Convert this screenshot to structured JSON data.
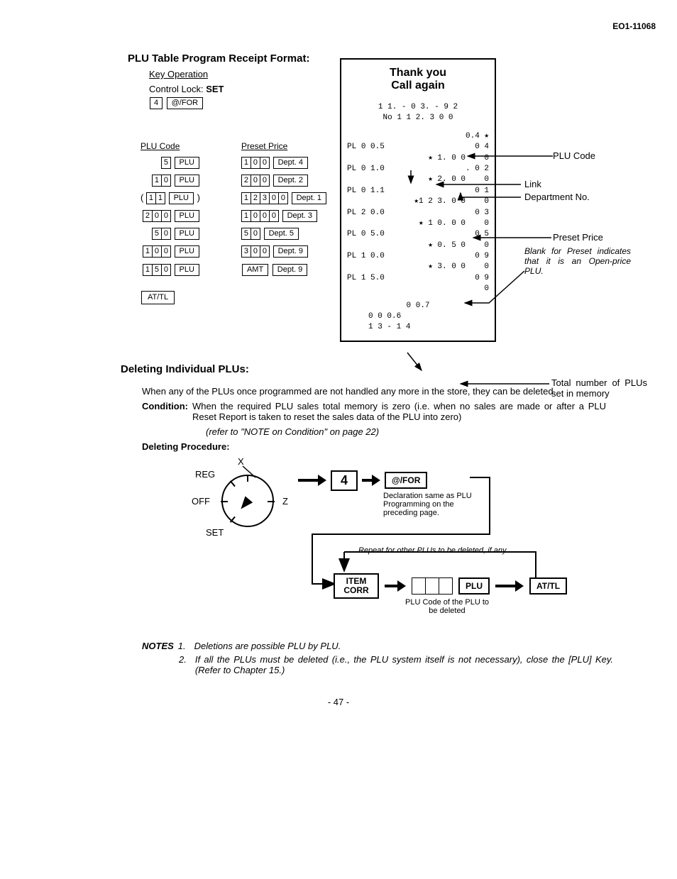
{
  "doc_id": "EO1-11068",
  "section1_title": "PLU Table Program Receipt Format:",
  "key_operation": "Key Operation",
  "control_lock": "Control Lock:",
  "control_lock_val": "SET",
  "first_keys": {
    "digit": "4",
    "key": "@/FOR"
  },
  "col_headers": {
    "plu": "PLU Code",
    "price": "Preset Price"
  },
  "plu_rows": [
    {
      "code": "5",
      "codekey": "PLU",
      "price": "100",
      "dept": "Dept. 4",
      "paren": false
    },
    {
      "code": "10",
      "codekey": "PLU",
      "price": "200",
      "dept": "Dept. 2",
      "paren": false
    },
    {
      "code": "11",
      "codekey": "PLU",
      "price": "12300",
      "dept": "Dept. 1",
      "paren": true
    },
    {
      "code": "200",
      "codekey": "PLU",
      "price": "1000",
      "dept": "Dept. 3",
      "paren": false
    },
    {
      "code": "50",
      "codekey": "PLU",
      "price": "50",
      "dept": "Dept. 5",
      "paren": false
    },
    {
      "code": "100",
      "codekey": "PLU",
      "price": "300",
      "dept": "Dept. 9",
      "paren": false
    },
    {
      "code": "150",
      "codekey": "PLU",
      "price": "AMT",
      "dept": "Dept. 9",
      "paren": false,
      "amt": true
    }
  ],
  "final_key": "AT/TL",
  "receipt": {
    "thank": "Thank you",
    "call": "Call  again",
    "date": "1 1. - 0 3. - 9 2",
    "no": "No 1 1 2. 3 0 0",
    "lines": [
      {
        "l": "",
        "r": "0.4 ★",
        "indent": 10
      },
      {
        "l": "PL 0 0.5",
        "r": "0 4"
      },
      {
        "l": "",
        "r": "★ 1. 0 0    0"
      },
      {
        "l": "PL 0 1.0",
        "r": ". 0 2"
      },
      {
        "l": "",
        "r": "★ 2. 0 0    0"
      },
      {
        "l": "PL 0 1.1",
        "r": "0 1"
      },
      {
        "l": "",
        "r": "★1 2 3. 0 0    0"
      },
      {
        "l": "PL 2 0.0",
        "r": "0 3"
      },
      {
        "l": "",
        "r": "★ 1 0. 0 0    0"
      },
      {
        "l": "PL 0 5.0",
        "r": "0 5"
      },
      {
        "l": "",
        "r": "★ 0. 5 0    0"
      },
      {
        "l": "PL 1 0.0",
        "r": "0 9"
      },
      {
        "l": "",
        "r": "★ 3. 0 0    0"
      },
      {
        "l": "PL 1 5.0",
        "r": "0 9"
      },
      {
        "l": "",
        "r": "0"
      }
    ],
    "foot1": "0 0.7",
    "foot2": "0 0 0.6",
    "foot3": "1 3 - 1 4"
  },
  "annotations": {
    "plu_code": "PLU Code",
    "link": "Link",
    "dept_no": "Department No.",
    "preset": "Preset Price",
    "preset_note": "Blank for Preset indicates that it is an Open-price PLU.",
    "total": "Total number of PLUs set in memory"
  },
  "deleting": {
    "title": "Deleting Individual PLUs:",
    "p1": "When any of the PLUs once programmed are not handled any more in the store, they can be deleted.",
    "cond_label": "Condition:",
    "cond_text": "When the required PLU sales total memory is zero (i.e. when no sales are made or after a PLU Reset Report is taken to reset the sales data of the PLU into zero)",
    "cond_ref": "(refer to \"NOTE on Condition\" on page 22)",
    "proc_label": "Deleting Procedure:",
    "dial": {
      "x": "X",
      "reg": "REG",
      "off": "OFF",
      "z": "Z",
      "set": "SET"
    },
    "flow": {
      "k4": "4",
      "kfor": "@/FOR",
      "decl": "Declaration same as PLU Programming on the preceding page.",
      "repeat": "Repeat for other PLUs to be deleted, if any.",
      "item": "ITEM CORR",
      "plu": "PLU",
      "attl": "AT/TL",
      "plucode": "PLU Code of the PLU to be deleted"
    }
  },
  "notes_label": "NOTES",
  "notes": [
    "Deletions are possible PLU by PLU.",
    "If all the PLUs must be deleted (i.e., the PLU system itself is not necessary), close the [PLU] Key. (Refer to Chapter 15.)"
  ],
  "page": "- 47 -"
}
